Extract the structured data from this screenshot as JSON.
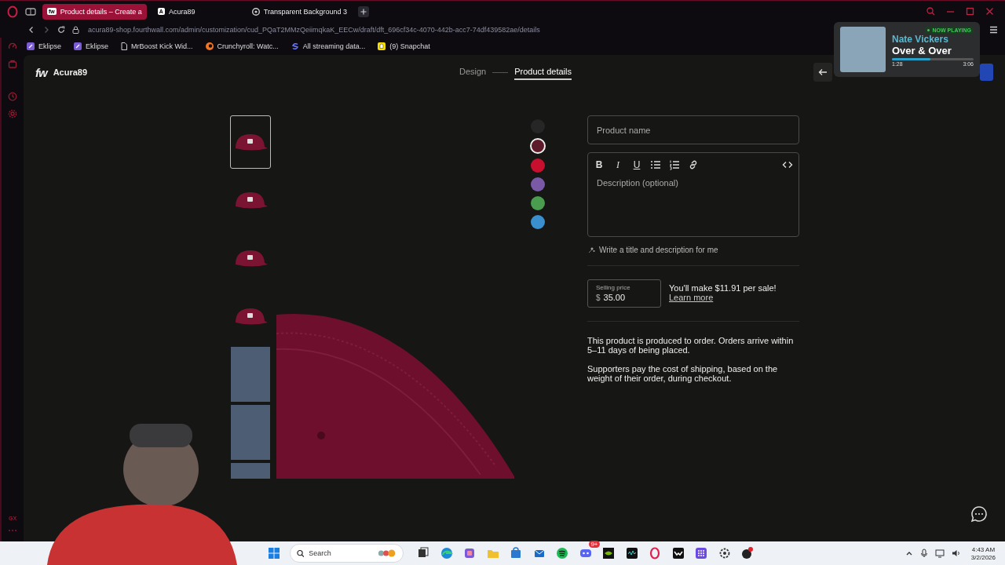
{
  "browser": {
    "tabs": [
      {
        "favicon": "fw",
        "label": "Product details – Create a",
        "selected": true
      },
      {
        "favicon": "A",
        "label": "Acura89",
        "selected": false
      },
      {
        "label": "Transparent Background 3",
        "selected": false
      }
    ],
    "url": "acura89-shop.fourthwall.com/admin/customization/cud_PQaT2MMzQeiimqkaK_EECw/draft/dft_696cf34c-4070-442b-acc7-74df439582ae/details",
    "bookmarks": [
      "Eklipse",
      "Eklipse",
      "MrBoost Kick Wid...",
      "Crunchyroll: Watc...",
      "All streaming data...",
      "(9) Snapchat"
    ]
  },
  "sidebar": {
    "label": "GX"
  },
  "store": {
    "logo": "fw",
    "name": "Acura89",
    "steps": [
      {
        "label": "Design",
        "selected": false
      },
      {
        "label": "Product details",
        "selected": true
      }
    ],
    "thumbnails": [
      {
        "kind": "cap",
        "selected": true
      },
      {
        "kind": "cap",
        "selected": false
      },
      {
        "kind": "cap",
        "selected": false
      },
      {
        "kind": "cap",
        "selected": false
      },
      {
        "kind": "model",
        "selected": false
      },
      {
        "kind": "model",
        "selected": false
      },
      {
        "kind": "model",
        "selected": false
      }
    ],
    "colors": [
      {
        "color": "#262626",
        "selected": false
      },
      {
        "color": "#5c1a2b",
        "selected": true
      },
      {
        "color": "#c8102e",
        "selected": false
      },
      {
        "color": "#7a5aa6",
        "selected": false
      },
      {
        "color": "#4a9c4e",
        "selected": false
      },
      {
        "color": "#3a90cf",
        "selected": false
      }
    ],
    "form": {
      "name": {
        "placeholder": "Product name"
      },
      "toolbar": [
        {
          "kind": "bold",
          "label": "B"
        },
        {
          "kind": "italic",
          "label": "I"
        },
        {
          "kind": "underline",
          "label": "U"
        },
        {
          "kind": "bullets"
        },
        {
          "kind": "numbers"
        },
        {
          "kind": "link"
        },
        {
          "kind": "code"
        }
      ],
      "description": {
        "placeholder": "Description (optional)"
      },
      "ai_link": "Write a title and description for me",
      "price": {
        "label": "Selling price",
        "currency": "$",
        "value": "35.00"
      },
      "earnings": "You'll make $11.91 per sale!",
      "learn_more": "Learn more",
      "notes": [
        "This product is produced to order. Orders arrive within 5–11 days of being placed.",
        "Supporters pay the cost of shipping, based on the weight of their order, during checkout."
      ]
    }
  },
  "now_playing": {
    "badge": "NOW PLAYING",
    "artist": "Nate Vickers",
    "title": "Over & Over",
    "elapsed": "1:28",
    "total": "3:06",
    "level": 0.47
  },
  "taskbar": {
    "search": {
      "placeholder": "Search"
    },
    "badge": "9+",
    "time": "4:43 AM",
    "date": "3/2/2026"
  }
}
